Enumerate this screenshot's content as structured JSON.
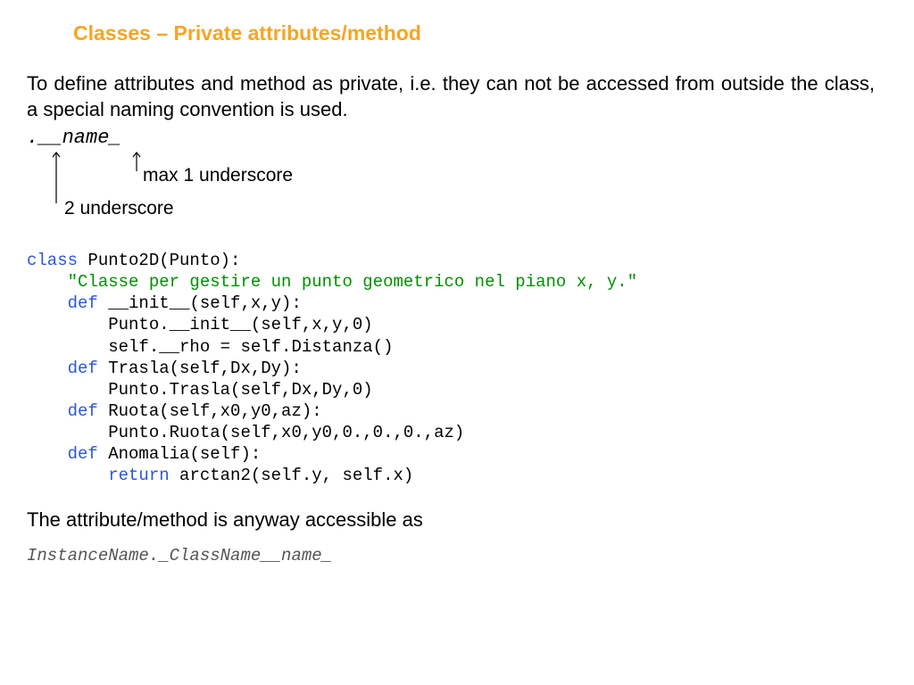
{
  "title": "Classes – Private attributes/method",
  "intro": "To define attributes and method as private, i.e. they can not be accessed from outside the class, a special naming convention is used.",
  "pattern": ".__name_",
  "annot_max1": "max 1 underscore",
  "annot_2u": "2 underscore",
  "code": {
    "l1_kw": "class",
    "l1_rest": " Punto2D(Punto):",
    "l2_doc": "    \"Classe per gestire un punto geometrico nel piano x, y.\"",
    "l3_def": "    def",
    "l3_rest": " __init__(self,x,y):",
    "l4": "        Punto.__init__(self,x,y,0)",
    "l5": "        self.__rho = self.Distanza()",
    "l6_def": "    def",
    "l6_rest": " Trasla(self,Dx,Dy):",
    "l7": "        Punto.Trasla(self,Dx,Dy,0)",
    "l8_def": "    def",
    "l8_rest": " Ruota(self,x0,y0,az):",
    "l9": "        Punto.Ruota(self,x0,y0,0.,0.,0.,az)",
    "l10_def": "    def",
    "l10_rest": " Anomalia(self):",
    "l11_ret": "        return",
    "l11_rest": " arctan2(self.y, self.x)"
  },
  "footer": "The attribute/method is anyway accessible as",
  "access": "InstanceName._ClassName__name_"
}
